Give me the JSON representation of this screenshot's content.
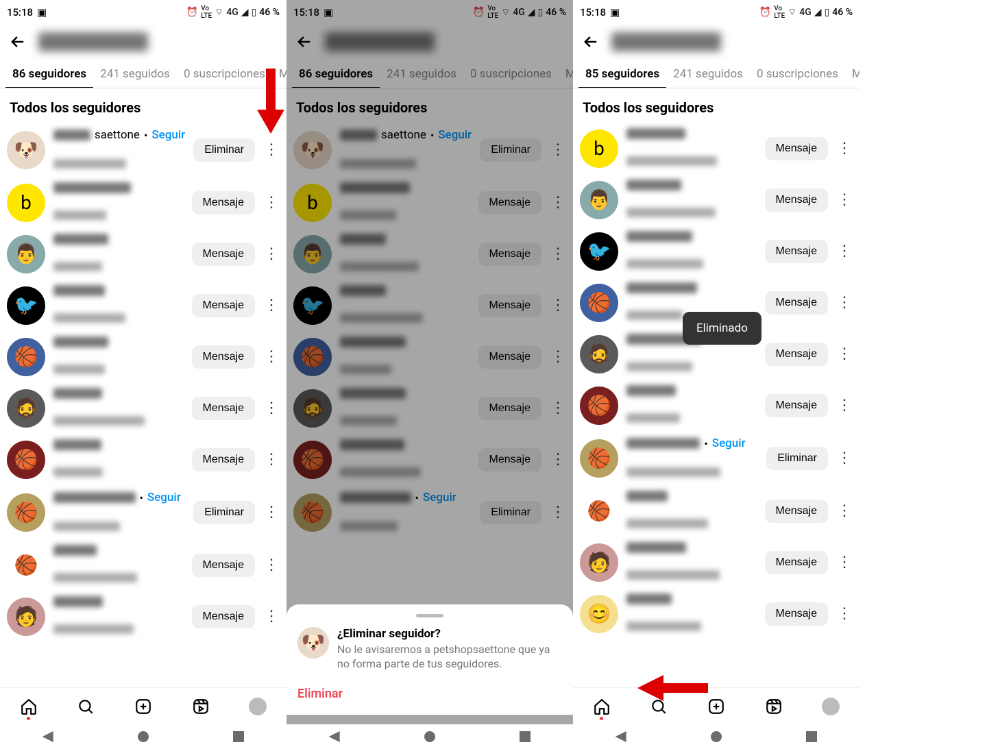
{
  "status": {
    "time": "15:18",
    "battery": "46 %",
    "net": "4G"
  },
  "header": {
    "username_suffix": "saettone",
    "follow": "Seguir",
    "dot": "•"
  },
  "tabs": {
    "followers_86": "86 seguidores",
    "followers_85": "85 seguidores",
    "following": "241 seguidos",
    "subs": "0 suscripciones",
    "brands": "Marcas"
  },
  "section_title": "Todos los seguidores",
  "buttons": {
    "eliminar": "Eliminar",
    "mensaje": "Mensaje"
  },
  "sheet": {
    "title": "¿Eliminar seguidor?",
    "body": "No le avisaremos a petshopsaettone que ya no forma parte de tus seguidores.",
    "action": "Eliminar"
  },
  "toast": {
    "text": "Eliminado"
  },
  "rows_a": [
    {
      "avatar": "🐶",
      "bg": "#e8d9c8",
      "suffix": true,
      "action": "eliminar"
    },
    {
      "avatar": "b",
      "bg": "#ffe600",
      "action": "mensaje"
    },
    {
      "avatar": "👨",
      "bg": "#8aa",
      "action": "mensaje"
    },
    {
      "avatar": "🐦",
      "bg": "#000",
      "action": "mensaje"
    },
    {
      "avatar": "🏀",
      "bg": "#4060a0",
      "action": "mensaje"
    },
    {
      "avatar": "🧔",
      "bg": "#5a5a5a",
      "action": "mensaje"
    },
    {
      "avatar": "🏀",
      "bg": "#7a1f1f",
      "action": "mensaje"
    },
    {
      "avatar": "🏀",
      "bg": "#b5a060",
      "follow": true,
      "action": "eliminar"
    },
    {
      "avatar": "🏀",
      "bg": "#fff",
      "ring": true,
      "action": "mensaje"
    },
    {
      "avatar": "🧑",
      "bg": "#c99",
      "action": "mensaje"
    }
  ],
  "rows_c": [
    {
      "avatar": "b",
      "bg": "#ffe600",
      "action": "mensaje"
    },
    {
      "avatar": "👨",
      "bg": "#8aa",
      "action": "mensaje"
    },
    {
      "avatar": "🐦",
      "bg": "#000",
      "action": "mensaje"
    },
    {
      "avatar": "🏀",
      "bg": "#4060a0",
      "action": "mensaje"
    },
    {
      "avatar": "🧔",
      "bg": "#5a5a5a",
      "action": "mensaje"
    },
    {
      "avatar": "🏀",
      "bg": "#7a1f1f",
      "action": "mensaje"
    },
    {
      "avatar": "🏀",
      "bg": "#b5a060",
      "follow": true,
      "action": "eliminar"
    },
    {
      "avatar": "🏀",
      "bg": "#fff",
      "ring": true,
      "action": "mensaje"
    },
    {
      "avatar": "🧑",
      "bg": "#c99",
      "action": "mensaje"
    },
    {
      "avatar": "😊",
      "bg": "#f4e090",
      "action": "mensaje"
    }
  ]
}
